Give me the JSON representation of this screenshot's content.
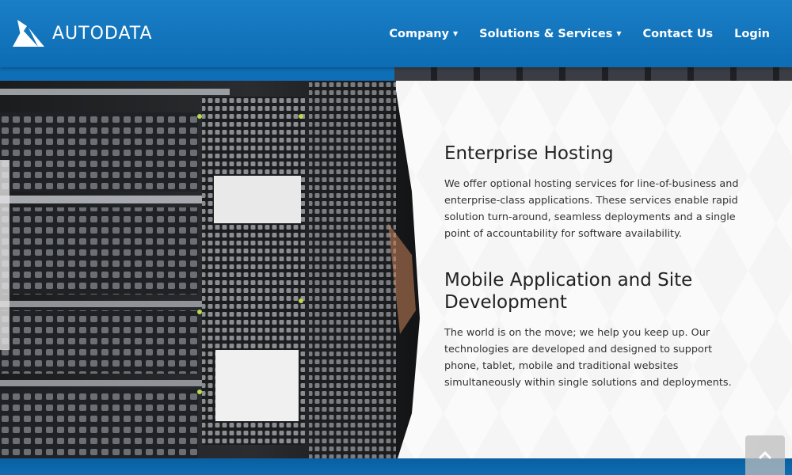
{
  "brand": {
    "name": "AUTODATA",
    "logo_icon": "autodata-logo-icon"
  },
  "nav": {
    "items": [
      {
        "label": "Company",
        "dropdown": true
      },
      {
        "label": "Solutions & Services",
        "dropdown": true
      },
      {
        "label": "Contact Us",
        "dropdown": false
      },
      {
        "label": "Login",
        "dropdown": false
      }
    ],
    "caret": "▼"
  },
  "sections": [
    {
      "title": "Enterprise Hosting",
      "body": "We offer optional hosting services for line-of-business and enterprise-class applications. These services enable rapid solution turn-around, seamless deployments and a single point of accountability for software availability."
    },
    {
      "title": "Mobile Application and Site Development",
      "body": "The world is on the move; we help you keep up. Our technologies are developed and designed to support phone, tablet, mobile and traditional websites simultaneously within single solutions and deployments."
    }
  ],
  "scroll_top": {
    "icon": "chevron-up-icon"
  },
  "colors": {
    "header": "#0d6cb3",
    "accent": "#1a7fc7",
    "text": "#333333"
  }
}
